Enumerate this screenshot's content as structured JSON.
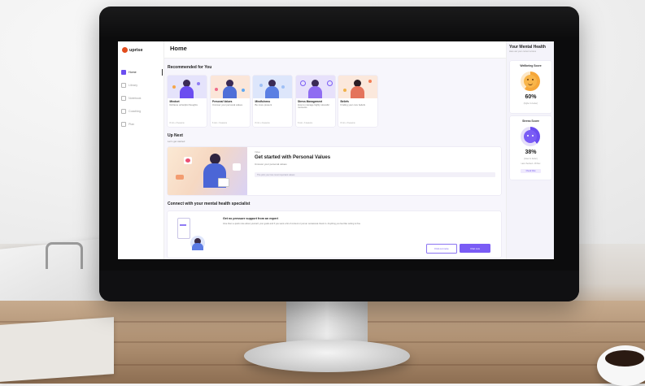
{
  "app": {
    "logo_text": "uprise",
    "page_title": "Home"
  },
  "sidebar": {
    "items": [
      {
        "label": "Home",
        "icon": "home-icon",
        "active": true
      },
      {
        "label": "Library",
        "icon": "library-icon",
        "active": false
      },
      {
        "label": "Notebook",
        "icon": "notebook-icon",
        "active": false
      },
      {
        "label": "Coaching",
        "icon": "phone-icon",
        "active": false
      },
      {
        "label": "Plan",
        "icon": "plan-icon",
        "active": false
      }
    ]
  },
  "recommended": {
    "title": "Recommended for You",
    "cards": [
      {
        "title": "Mindset",
        "desc": "Reframe unhelpful thoughts",
        "meta": "8 min • 3 lessons",
        "tint": "#e5e3fb"
      },
      {
        "title": "Personal Values",
        "desc": "Uncover your personal values",
        "meta": "6 min • 3 lessons",
        "tint": "#fbe6d9"
      },
      {
        "title": "Mindfulness",
        "desc": "Be more present",
        "meta": "8 min • 4 lessons",
        "tint": "#dde6fb"
      },
      {
        "title": "Stress Management",
        "desc": "How to manage highly stressful moments",
        "meta": "8 min • 3 lessons",
        "tint": "#e7e1fb"
      },
      {
        "title": "Beliefs",
        "desc": "Finding your core beliefs",
        "meta": "8 min • 3 lessons",
        "tint": "#fbe8dc"
      }
    ]
  },
  "up_next": {
    "title": "Up Next",
    "subtitle": "Let's get started",
    "card": {
      "type": "Video",
      "title": "Get started with Personal Values",
      "desc": "Uncover your personal values",
      "progress_text": "The pick your two most important values"
    }
  },
  "connect": {
    "title": "Connect with your mental health specialist",
    "card_title": "Get no pressure support from an expert",
    "card_desc": "Give them a quick note about yourself, your goals and if you want a bit of context or just an occasional check in. Anything you feel like writing is fine.",
    "btn_secondary": "Find out more",
    "btn_primary": "Chat now"
  },
  "right_panel": {
    "title": "Your Mental Health",
    "subtitle": "Here are your current scores",
    "wellbeing": {
      "label": "Wellbeing Score",
      "value": "60%",
      "note": "(higher is better)",
      "level": 0.6
    },
    "stress": {
      "label": "Stress Score",
      "value": "38%",
      "note": "(lower is better)",
      "note2": "Last checked • 18 Dec",
      "button": "Check Now",
      "level": 0.38
    }
  },
  "colors": {
    "accent": "#6b4df0",
    "brand": "#e24c1c",
    "wellbeing": "#f6a73a"
  }
}
